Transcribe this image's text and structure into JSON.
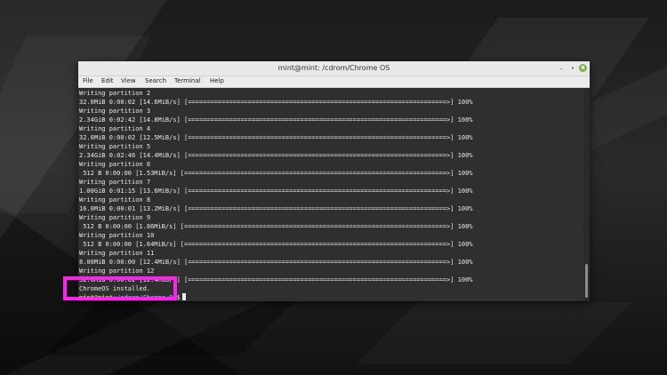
{
  "window": {
    "title": "mint@mint: /cdrom/Chrome OS",
    "minimize_icon": "–",
    "maximize_icon": "•",
    "close_icon": "✖"
  },
  "menu": [
    "File",
    "Edit",
    "View",
    "Search",
    "Terminal",
    "Help"
  ],
  "terminal_lines": [
    "Writing partition 2",
    "32.0MiB 0:00:02 [14.6MiB/s] [=====================================================================>] 100%",
    "Writing partition 3",
    "2.34GiB 0:02:42 [14.8MiB/s] [=====================================================================>] 100%",
    "Writing partition 4",
    "32.0MiB 0:00:02 [12.5MiB/s] [=====================================================================>] 100%",
    "Writing partition 5",
    "2.34GiB 0:02:46 [14.4MiB/s] [=====================================================================>] 100%",
    "Writing partition 6",
    " 512 B 0:00:00 [1.53MiB/s] [======================================================================>] 100%",
    "Writing partition 7",
    "1.00GiB 0:01:15 [13.6MiB/s] [=====================================================================>] 100%",
    "Writing partition 8",
    "16.0MiB 0:00:01 [13.2MiB/s] [=====================================================================>] 100%",
    "Writing partition 9",
    " 512 B 0:00:00 [1.86MiB/s] [======================================================================>] 100%",
    "Writing partition 10",
    " 512 B 0:00:00 [1.64MiB/s] [======================================================================>] 100%",
    "Writing partition 11",
    "8.00MiB 0:00:00 [12.4MiB/s] [=====================================================================>] 100%",
    "Writing partition 12",
    "32.0MiB 0:00:02 [12.4MiB/s] [=====================================================================>] 100%",
    "ChromeOS installed."
  ],
  "prompt": {
    "user": "mint@mint",
    "path": ":/cdrom/Chrome OS",
    "symbol": "$"
  },
  "colors": {
    "highlight": "#ff22ee",
    "prompt_user": "#8ae234",
    "prompt_path": "#6fa8dc"
  }
}
